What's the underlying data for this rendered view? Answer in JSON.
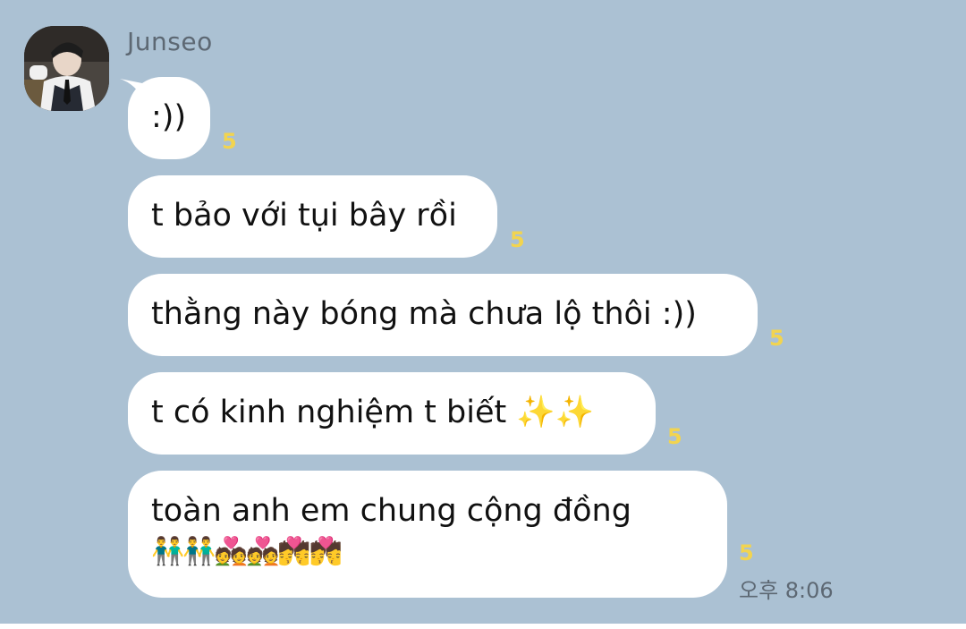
{
  "chat": {
    "sender_name": "Junseo",
    "messages": [
      {
        "text": ":))",
        "unread": "5"
      },
      {
        "text": "t bảo với tụi bây rồi",
        "unread": "5"
      },
      {
        "text": "thằng này bóng mà chưa lộ thôi :))",
        "unread": "5"
      },
      {
        "text": "t có kinh nghiệm t biết ✨✨",
        "unread": "5"
      },
      {
        "text_line1": "toàn anh em chung cộng đồng",
        "text_line2": "👬👬💑💑💏💏",
        "unread": "5",
        "time": "오후 8:06"
      }
    ]
  },
  "colors": {
    "background": "#abc1d3",
    "bubble": "#ffffff",
    "unread_count": "#f2d44f"
  }
}
